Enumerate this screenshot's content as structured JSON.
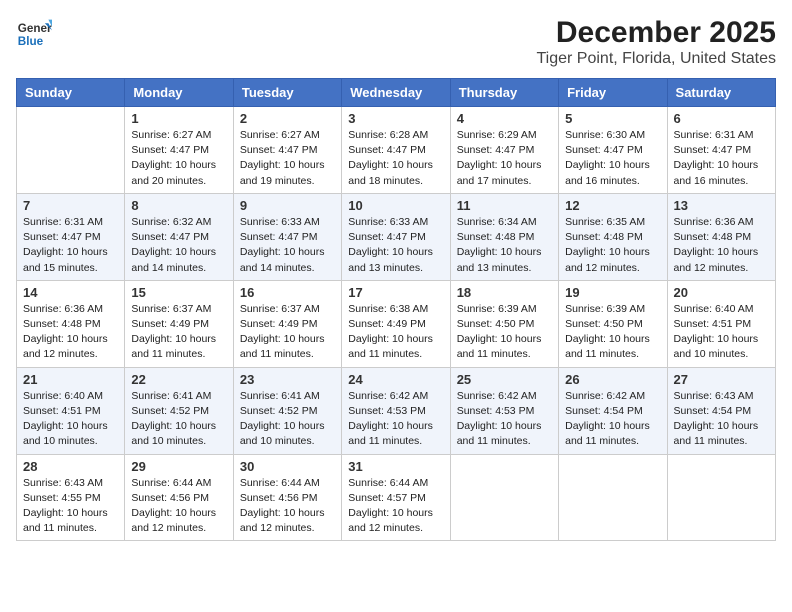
{
  "header": {
    "logo_general": "General",
    "logo_blue": "Blue",
    "month_title": "December 2025",
    "location": "Tiger Point, Florida, United States"
  },
  "weekdays": [
    "Sunday",
    "Monday",
    "Tuesday",
    "Wednesday",
    "Thursday",
    "Friday",
    "Saturday"
  ],
  "weeks": [
    [
      {
        "day": "",
        "info": ""
      },
      {
        "day": "1",
        "info": "Sunrise: 6:27 AM\nSunset: 4:47 PM\nDaylight: 10 hours\nand 20 minutes."
      },
      {
        "day": "2",
        "info": "Sunrise: 6:27 AM\nSunset: 4:47 PM\nDaylight: 10 hours\nand 19 minutes."
      },
      {
        "day": "3",
        "info": "Sunrise: 6:28 AM\nSunset: 4:47 PM\nDaylight: 10 hours\nand 18 minutes."
      },
      {
        "day": "4",
        "info": "Sunrise: 6:29 AM\nSunset: 4:47 PM\nDaylight: 10 hours\nand 17 minutes."
      },
      {
        "day": "5",
        "info": "Sunrise: 6:30 AM\nSunset: 4:47 PM\nDaylight: 10 hours\nand 16 minutes."
      },
      {
        "day": "6",
        "info": "Sunrise: 6:31 AM\nSunset: 4:47 PM\nDaylight: 10 hours\nand 16 minutes."
      }
    ],
    [
      {
        "day": "7",
        "info": "Sunrise: 6:31 AM\nSunset: 4:47 PM\nDaylight: 10 hours\nand 15 minutes."
      },
      {
        "day": "8",
        "info": "Sunrise: 6:32 AM\nSunset: 4:47 PM\nDaylight: 10 hours\nand 14 minutes."
      },
      {
        "day": "9",
        "info": "Sunrise: 6:33 AM\nSunset: 4:47 PM\nDaylight: 10 hours\nand 14 minutes."
      },
      {
        "day": "10",
        "info": "Sunrise: 6:33 AM\nSunset: 4:47 PM\nDaylight: 10 hours\nand 13 minutes."
      },
      {
        "day": "11",
        "info": "Sunrise: 6:34 AM\nSunset: 4:48 PM\nDaylight: 10 hours\nand 13 minutes."
      },
      {
        "day": "12",
        "info": "Sunrise: 6:35 AM\nSunset: 4:48 PM\nDaylight: 10 hours\nand 12 minutes."
      },
      {
        "day": "13",
        "info": "Sunrise: 6:36 AM\nSunset: 4:48 PM\nDaylight: 10 hours\nand 12 minutes."
      }
    ],
    [
      {
        "day": "14",
        "info": "Sunrise: 6:36 AM\nSunset: 4:48 PM\nDaylight: 10 hours\nand 12 minutes."
      },
      {
        "day": "15",
        "info": "Sunrise: 6:37 AM\nSunset: 4:49 PM\nDaylight: 10 hours\nand 11 minutes."
      },
      {
        "day": "16",
        "info": "Sunrise: 6:37 AM\nSunset: 4:49 PM\nDaylight: 10 hours\nand 11 minutes."
      },
      {
        "day": "17",
        "info": "Sunrise: 6:38 AM\nSunset: 4:49 PM\nDaylight: 10 hours\nand 11 minutes."
      },
      {
        "day": "18",
        "info": "Sunrise: 6:39 AM\nSunset: 4:50 PM\nDaylight: 10 hours\nand 11 minutes."
      },
      {
        "day": "19",
        "info": "Sunrise: 6:39 AM\nSunset: 4:50 PM\nDaylight: 10 hours\nand 11 minutes."
      },
      {
        "day": "20",
        "info": "Sunrise: 6:40 AM\nSunset: 4:51 PM\nDaylight: 10 hours\nand 10 minutes."
      }
    ],
    [
      {
        "day": "21",
        "info": "Sunrise: 6:40 AM\nSunset: 4:51 PM\nDaylight: 10 hours\nand 10 minutes."
      },
      {
        "day": "22",
        "info": "Sunrise: 6:41 AM\nSunset: 4:52 PM\nDaylight: 10 hours\nand 10 minutes."
      },
      {
        "day": "23",
        "info": "Sunrise: 6:41 AM\nSunset: 4:52 PM\nDaylight: 10 hours\nand 10 minutes."
      },
      {
        "day": "24",
        "info": "Sunrise: 6:42 AM\nSunset: 4:53 PM\nDaylight: 10 hours\nand 11 minutes."
      },
      {
        "day": "25",
        "info": "Sunrise: 6:42 AM\nSunset: 4:53 PM\nDaylight: 10 hours\nand 11 minutes."
      },
      {
        "day": "26",
        "info": "Sunrise: 6:42 AM\nSunset: 4:54 PM\nDaylight: 10 hours\nand 11 minutes."
      },
      {
        "day": "27",
        "info": "Sunrise: 6:43 AM\nSunset: 4:54 PM\nDaylight: 10 hours\nand 11 minutes."
      }
    ],
    [
      {
        "day": "28",
        "info": "Sunrise: 6:43 AM\nSunset: 4:55 PM\nDaylight: 10 hours\nand 11 minutes."
      },
      {
        "day": "29",
        "info": "Sunrise: 6:44 AM\nSunset: 4:56 PM\nDaylight: 10 hours\nand 12 minutes."
      },
      {
        "day": "30",
        "info": "Sunrise: 6:44 AM\nSunset: 4:56 PM\nDaylight: 10 hours\nand 12 minutes."
      },
      {
        "day": "31",
        "info": "Sunrise: 6:44 AM\nSunset: 4:57 PM\nDaylight: 10 hours\nand 12 minutes."
      },
      {
        "day": "",
        "info": ""
      },
      {
        "day": "",
        "info": ""
      },
      {
        "day": "",
        "info": ""
      }
    ]
  ]
}
